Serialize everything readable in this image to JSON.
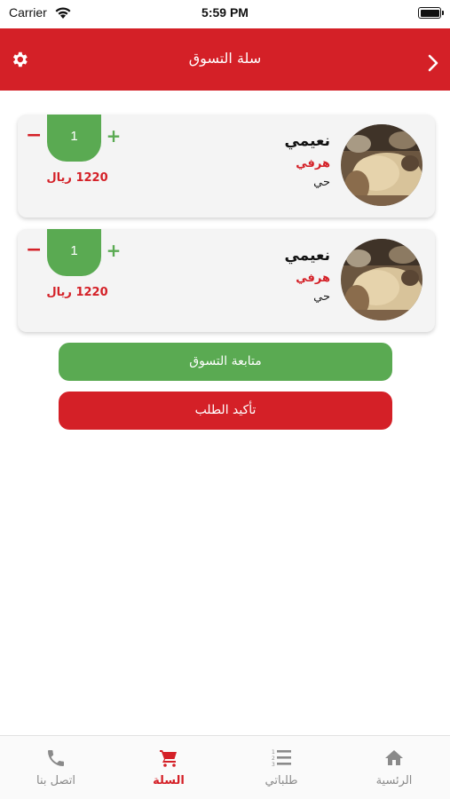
{
  "status_bar": {
    "carrier": "Carrier",
    "time": "5:59 PM"
  },
  "header": {
    "title": "سلة التسوق",
    "settings_icon": "gear-icon",
    "back_icon": "chevron-right-icon",
    "color": "#d42027"
  },
  "cart_items": [
    {
      "name": "نعيمي",
      "size": "هرفي",
      "state": "حي",
      "quantity": "1",
      "price": "1220 ريال",
      "minus": "−",
      "plus": "+"
    },
    {
      "name": "نعيمي",
      "size": "هرفي",
      "state": "حي",
      "quantity": "1",
      "price": "1220 ريال",
      "minus": "−",
      "plus": "+"
    }
  ],
  "actions": {
    "continue_label": "متابعة التسوق",
    "confirm_label": "تأكيد الطلب",
    "continue_color": "#5aaa52",
    "confirm_color": "#d42027"
  },
  "tab_bar": {
    "tabs": [
      {
        "label": "اتصل بنا",
        "icon": "phone-icon",
        "active": false
      },
      {
        "label": "السلة",
        "icon": "cart-icon",
        "active": true
      },
      {
        "label": "طلباتي",
        "icon": "list-icon",
        "active": false
      },
      {
        "label": "الرئسية",
        "icon": "home-icon",
        "active": false
      }
    ]
  }
}
